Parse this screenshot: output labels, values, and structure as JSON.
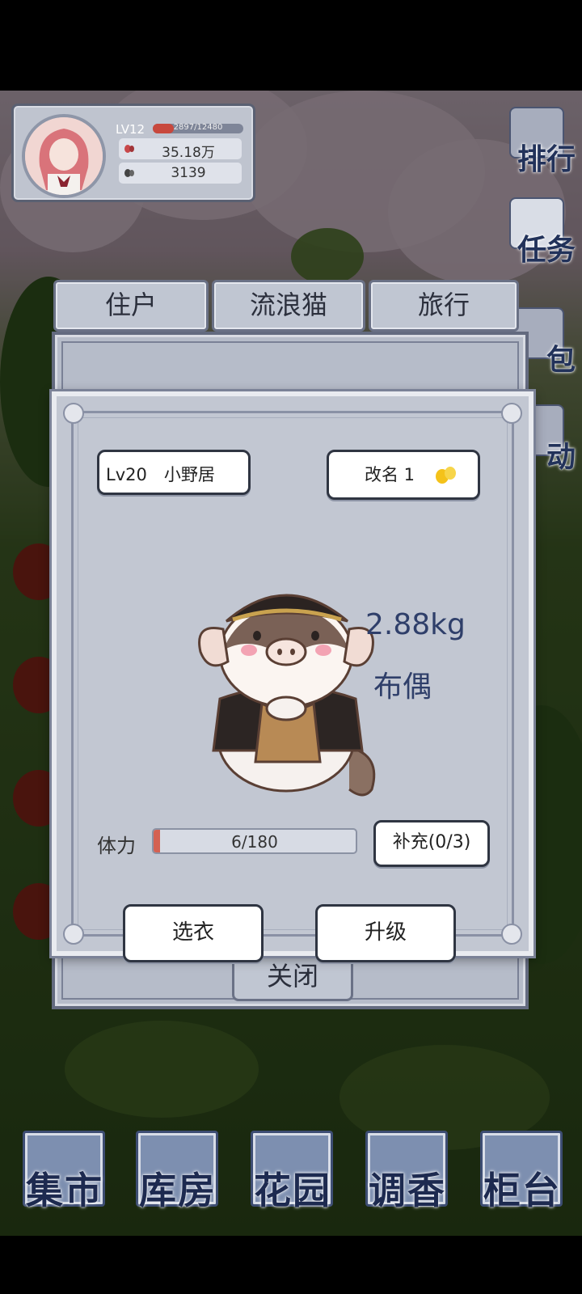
{
  "player": {
    "level": "LV12",
    "exp": "2897/12480",
    "currency1": "35.18万",
    "currency2": "3139"
  },
  "side_nav": [
    {
      "label": "排行",
      "icon": "ranking-icon"
    },
    {
      "label": "任务",
      "icon": "task-icon"
    },
    {
      "label": "包",
      "icon": "bag-icon"
    },
    {
      "label": "动",
      "icon": "activity-icon"
    }
  ],
  "tabs": [
    {
      "label": "住户",
      "active": true
    },
    {
      "label": "流浪猫",
      "active": false
    },
    {
      "label": "旅行",
      "active": false
    }
  ],
  "close_label": "关闭",
  "pet": {
    "level_name": "Lv20　小野居",
    "rename_label": "改名 1",
    "weight": "2.88kg",
    "outfit": "布偶",
    "stamina_label": "体力",
    "stamina_text": "6/180",
    "stamina_fraction": 0.033,
    "refill_label": "补充(0/3)",
    "choose_outfit_label": "选衣",
    "upgrade_label": "升级"
  },
  "bottom_nav": [
    {
      "label": "集市"
    },
    {
      "label": "库房"
    },
    {
      "label": "花园"
    },
    {
      "label": "调香"
    },
    {
      "label": "柜台"
    }
  ],
  "colors": {
    "accent_text": "#2f3f6a",
    "stamina_fill": "#d46152",
    "panel_bg": "#c2c7d2"
  }
}
